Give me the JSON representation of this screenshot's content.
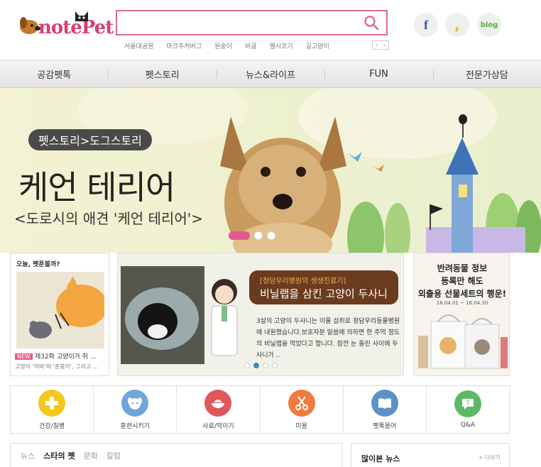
{
  "header": {
    "logo_text": "notePet",
    "search_placeholder": "",
    "keywords": [
      "서울대공원",
      "마크주커버그",
      "원숭이",
      "비글",
      "웰시코기",
      "길고양이"
    ],
    "social": {
      "facebook": "f",
      "kakaostory": ",",
      "blog": "blog"
    }
  },
  "nav": {
    "items": [
      "공감펫톡",
      "펫스토리",
      "뉴스&라이프",
      "FUN",
      "전문가상담"
    ]
  },
  "hero": {
    "badge": "펫스토리>도그스토리",
    "title": "케언 테리어",
    "subtitle": "<도로시의 애견 '케언 테리어'>",
    "slide_count": 3,
    "active_slide": 1
  },
  "today": {
    "title": "오늘, 펫툰볼까?",
    "new_badge": "NEW",
    "headline": "제32화 고양이가 쥐 ...",
    "desc": "고양이 '이바'와 '춘봉이', 그리고 ..."
  },
  "feature": {
    "tag": "[청담우리병원의 생생진료기]",
    "headline": "비닐랩을 삼킨 고양이 두사니",
    "body": "3살의 고양이 두사니는 이물 섭취로 청담우리동물병원에 내원했습니다.보호자분 말씀에 의하면 한 주먹 정도의 비닐랩을 먹었다고 합니다. 잠깐 눈 돌린 사이에 두사니가 ..",
    "active_dot": 2
  },
  "promo": {
    "line1": "반려동물 정보",
    "line2": "등록만 해도",
    "line3": "외출용 선물세트의 행운!",
    "date": "16.04.01 ~ 16.04.30"
  },
  "categories": [
    {
      "label": "건강/질병",
      "color": "#f2c81e",
      "icon": "health-icon"
    },
    {
      "label": "훈련시키기",
      "color": "#6ea6d9",
      "icon": "dog-face-icon"
    },
    {
      "label": "사료/먹이기",
      "color": "#e0575a",
      "icon": "food-bowl-icon"
    },
    {
      "label": "미용",
      "color": "#f07b3f",
      "icon": "grooming-icon"
    },
    {
      "label": "펫톡용어",
      "color": "#5a93c8",
      "icon": "book-icon"
    },
    {
      "label": "Q&A",
      "color": "#5cba67",
      "icon": "question-icon"
    }
  ],
  "bottom_tabs": {
    "items": [
      "뉴스",
      "스타의 펫",
      "문화",
      "칼럼"
    ],
    "active": 1
  },
  "popular": {
    "title": "많이본 뉴스",
    "more": "+ 더보기"
  }
}
